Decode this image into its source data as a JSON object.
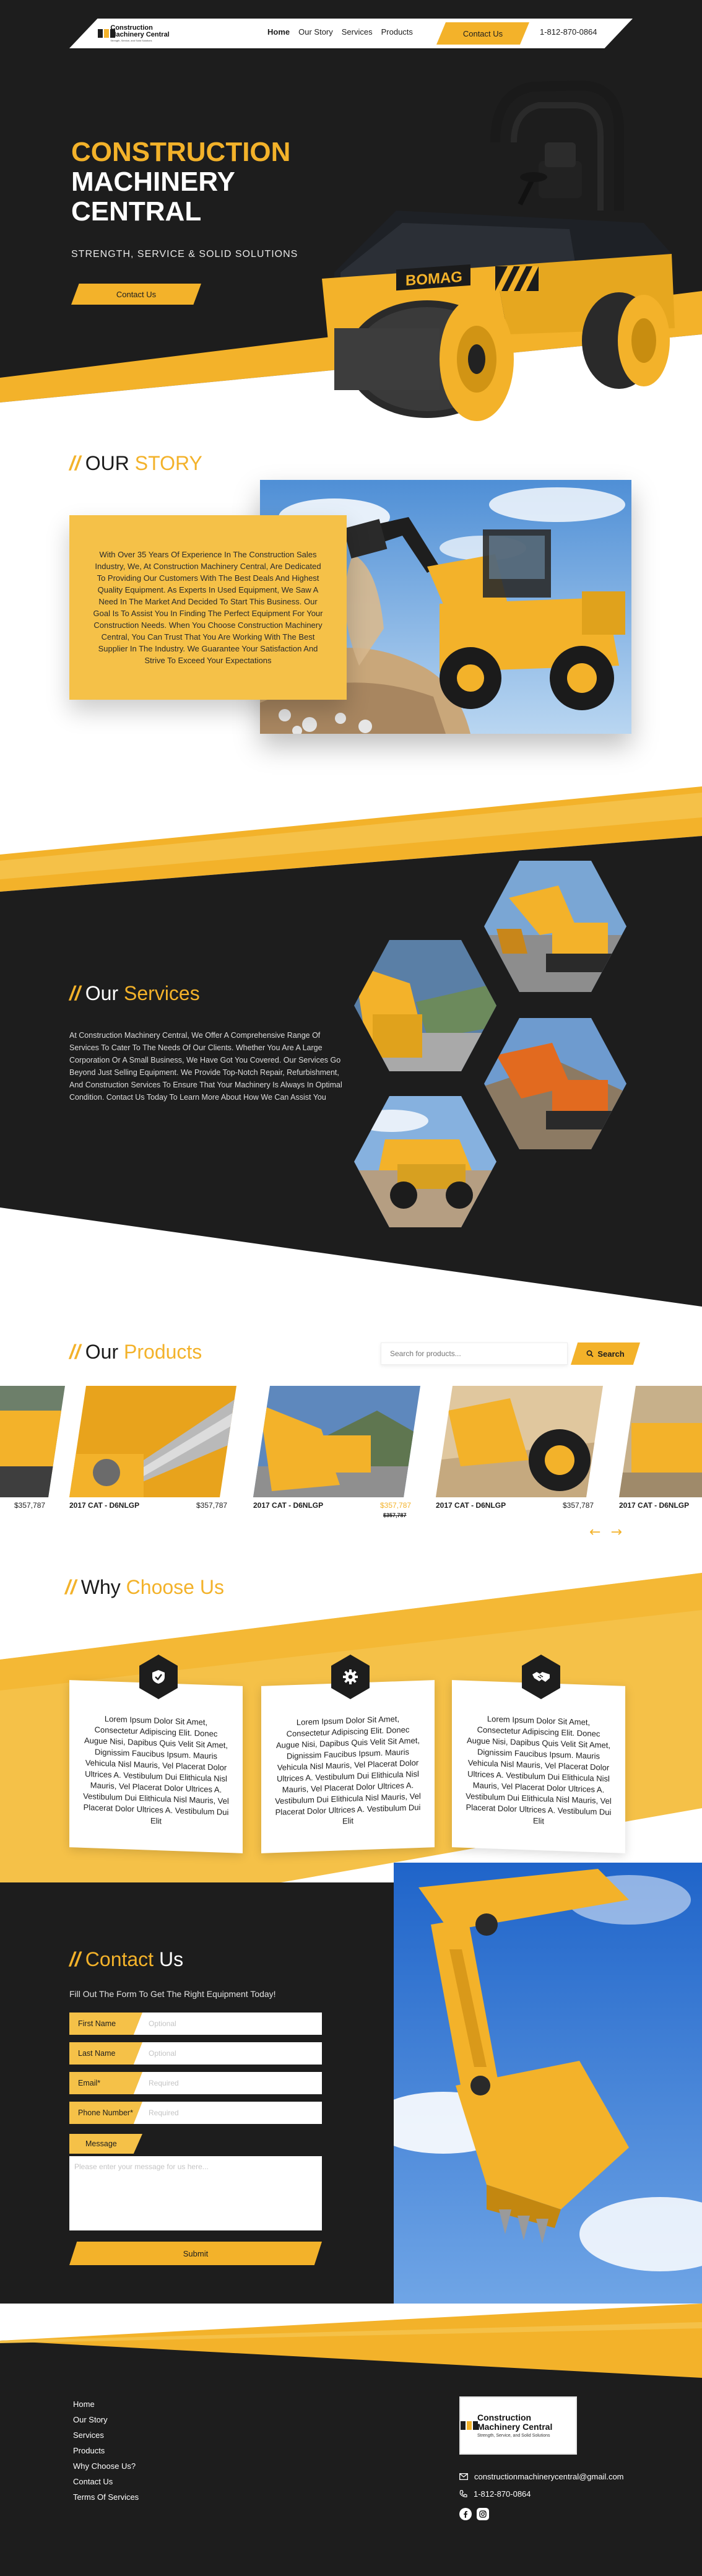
{
  "nav": {
    "logo_name": "Construction Machinery Central",
    "logo_tagline": "Strength, Service, and Solid Solutions",
    "links": [
      "Home",
      "Our Story",
      "Services",
      "Products"
    ],
    "contact_label": "Contact Us",
    "phone": "1-812-870-0864"
  },
  "hero": {
    "title_line1": "CONSTRUCTION",
    "title_line2": "MACHINERY",
    "title_line3": "CENTRAL",
    "subtitle": "STRENGTH, SERVICE & SOLID SOLUTIONS",
    "cta_label": "Contact Us",
    "roller_brand": "BOMAG"
  },
  "story": {
    "title_a": "OUR",
    "title_b": "STORY",
    "body": "With Over 35 Years Of Experience In The Construction Sales Industry, We, At Construction Machinery Central, Are Dedicated To Providing Our Customers With The Best Deals And Highest Quality Equipment. As Experts In Used Equipment, We Saw A Need In The Market And Decided To Start This Business. Our Goal Is To Assist You In Finding The Perfect Equipment For Your Construction Needs. When You Choose Construction Machinery Central, You Can Trust That You Are Working With The Best Supplier In The Industry. We Guarantee Your Satisfaction And Strive To Exceed Your Expectations"
  },
  "services": {
    "title_a": "Our",
    "title_b": "Services",
    "body": "At Construction Machinery Central, We Offer A Comprehensive Range Of Services To Cater To The Needs Of Our Clients. Whether You Are A Large Corporation Or A Small Business, We Have Got You Covered. Our Services Go Beyond Just Selling Equipment. We Provide Top-Notch Repair, Refurbishment, And Construction Services To Ensure That Your Machinery Is Always In Optimal Condition. Contact Us Today To Learn More About How We Can Assist You"
  },
  "products": {
    "title_a": "Our",
    "title_b": "Products",
    "search_placeholder": "Search for products...",
    "search_label": "Search",
    "edge_price": "$357,787",
    "items": [
      {
        "name": "2017 CAT - D6NLGP",
        "price": "$357,787",
        "old_price": ""
      },
      {
        "name": "2017 CAT - D6NLGP",
        "price": "$357,787",
        "old_price": "$357,787"
      },
      {
        "name": "2017 CAT - D6NLGP",
        "price": "$357,787",
        "old_price": ""
      },
      {
        "name": "2017 CAT - D6NLGP",
        "price": "",
        "old_price": ""
      }
    ],
    "prev_arrow": "←",
    "next_arrow": "→"
  },
  "why": {
    "title_a": "Why",
    "title_b": "Choose Us",
    "cards": [
      {
        "icon": "shield-check-icon",
        "text": "Lorem Ipsum Dolor Sit Amet, Consectetur Adipiscing Elit. Donec Augue Nisi, Dapibus Quis Velit Sit Amet, Dignissim Faucibus Ipsum. Mauris Vehicula Nisl Mauris, Vel Placerat Dolor Ultrices A. Vestibulum Dui Elithicula Nisl Mauris, Vel Placerat Dolor Ultrices A. Vestibulum Dui Elithicula Nisl Mauris, Vel Placerat Dolor Ultrices A. Vestibulum Dui Elit"
      },
      {
        "icon": "gear-icon",
        "text": "Lorem Ipsum Dolor Sit Amet, Consectetur Adipiscing Elit. Donec Augue Nisi, Dapibus Quis Velit Sit Amet, Dignissim Faucibus Ipsum. Mauris Vehicula Nisl Mauris, Vel Placerat Dolor Ultrices A. Vestibulum Dui Elithicula Nisl Mauris, Vel Placerat Dolor Ultrices A. Vestibulum Dui Elithicula Nisl Mauris, Vel Placerat Dolor Ultrices A. Vestibulum Dui Elit"
      },
      {
        "icon": "handshake-icon",
        "text": "Lorem Ipsum Dolor Sit Amet, Consectetur Adipiscing Elit. Donec Augue Nisi, Dapibus Quis Velit Sit Amet, Dignissim Faucibus Ipsum. Mauris Vehicula Nisl Mauris, Vel Placerat Dolor Ultrices A. Vestibulum Dui Elithicula Nisl Mauris, Vel Placerat Dolor Ultrices A. Vestibulum Dui Elithicula Nisl Mauris, Vel Placerat Dolor Ultrices A. Vestibulum Dui Elit"
      }
    ]
  },
  "contact": {
    "title_a": "Contact",
    "title_b": "Us",
    "subtitle": "Fill Out The Form To Get The Right Equipment Today!",
    "fields": [
      {
        "label": "First Name",
        "placeholder": "Optional"
      },
      {
        "label": "Last Name",
        "placeholder": "Optional"
      },
      {
        "label": "Email*",
        "placeholder": "Required"
      },
      {
        "label": "Phone Number*",
        "placeholder": "Required"
      }
    ],
    "message_label": "Message",
    "message_placeholder": "Please enter your message for us here...",
    "submit_label": "Submit"
  },
  "footer": {
    "links": [
      "Home",
      "Our Story",
      "Services",
      "Products",
      "Why Choose Us?",
      "Contact Us",
      "Terms Of Services"
    ],
    "email": "constructionmachinerycentral@gmail.com",
    "phone": "1-812-870-0864",
    "logo_name": "Construction Machinery Central",
    "logo_tagline": "Strength, Service, and Solid Solutions"
  },
  "colors": {
    "accent": "#f3b22a",
    "dark": "#1d1d1d",
    "light_accent": "#f5c148"
  }
}
